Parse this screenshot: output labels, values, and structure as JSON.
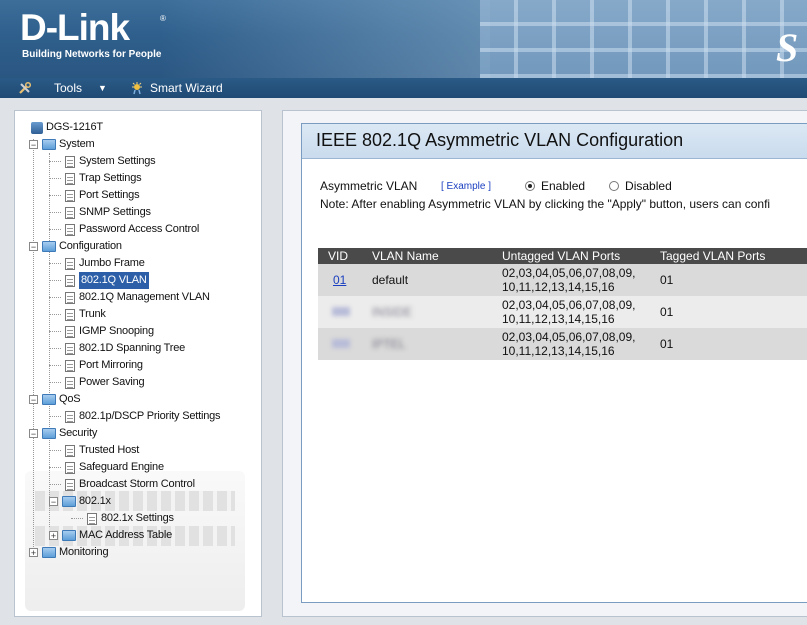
{
  "header": {
    "logo_title": "D-Link",
    "logo_registered": "®",
    "logo_subtitle": "Building Networks for People",
    "brand_mark": "S"
  },
  "menubar": {
    "tools_label": "Tools",
    "smart_wizard_label": "Smart Wizard"
  },
  "sidebar": {
    "tree": [
      {
        "label": "DGS-1216T",
        "icon": "device-icon",
        "level": 0
      },
      {
        "label": "System",
        "icon": "folder-icon",
        "level": 1,
        "expander": "−"
      },
      {
        "label": "System Settings",
        "icon": "page-icon",
        "level": 2
      },
      {
        "label": "Trap Settings",
        "icon": "page-icon",
        "level": 2
      },
      {
        "label": "Port Settings",
        "icon": "page-icon",
        "level": 2
      },
      {
        "label": "SNMP Settings",
        "icon": "page-icon",
        "level": 2
      },
      {
        "label": "Password Access Control",
        "icon": "page-icon",
        "level": 2
      },
      {
        "label": "Configuration",
        "icon": "folder-icon",
        "level": 1,
        "expander": "−"
      },
      {
        "label": "Jumbo Frame",
        "icon": "page-icon",
        "level": 2
      },
      {
        "label": "802.1Q VLAN",
        "icon": "page-icon",
        "level": 2,
        "selected": true
      },
      {
        "label": "802.1Q Management VLAN",
        "icon": "page-icon",
        "level": 2
      },
      {
        "label": "Trunk",
        "icon": "page-icon",
        "level": 2
      },
      {
        "label": "IGMP Snooping",
        "icon": "page-icon",
        "level": 2
      },
      {
        "label": "802.1D Spanning Tree",
        "icon": "page-icon",
        "level": 2
      },
      {
        "label": "Port Mirroring",
        "icon": "page-icon",
        "level": 2
      },
      {
        "label": "Power Saving",
        "icon": "page-icon",
        "level": 2
      },
      {
        "label": "QoS",
        "icon": "folder-icon",
        "level": 1,
        "expander": "−"
      },
      {
        "label": "802.1p/DSCP Priority Settings",
        "icon": "page-icon",
        "level": 2
      },
      {
        "label": "Security",
        "icon": "folder-icon",
        "level": 1,
        "expander": "−"
      },
      {
        "label": "Trusted Host",
        "icon": "page-icon",
        "level": 2
      },
      {
        "label": "Safeguard Engine",
        "icon": "page-icon",
        "level": 2
      },
      {
        "label": "Broadcast Storm Control",
        "icon": "page-icon",
        "level": 2
      },
      {
        "label": "802.1x",
        "icon": "folder-icon",
        "level": 2,
        "expander": "−"
      },
      {
        "label": "802.1x Settings",
        "icon": "page-icon",
        "level": 3
      },
      {
        "label": "MAC Address Table",
        "icon": "folder-icon",
        "level": 2,
        "expander": "+"
      },
      {
        "label": "Monitoring",
        "icon": "folder-icon",
        "level": 1,
        "expander": "+"
      }
    ]
  },
  "main": {
    "page_title": "IEEE 802.1Q Asymmetric VLAN Configuration",
    "asym_label": "Asymmetric VLAN",
    "example_link": "[ Example ]",
    "enabled_label": "Enabled",
    "disabled_label": "Disabled",
    "asymmetric_enabled": true,
    "note": "Note: After enabling Asymmetric VLAN by clicking the \"Apply\" button, users can confi",
    "table": {
      "headers": [
        "VID",
        "VLAN Name",
        "Untagged VLAN Ports",
        "Tagged VLAN Ports"
      ],
      "rows": [
        {
          "vid": "01",
          "name": "default",
          "untagged_1": "02,03,04,05,06,07,08,09,",
          "untagged_2": "10,11,12,13,14,15,16",
          "tagged": "01",
          "obscured": false
        },
        {
          "vid": "",
          "name": "INSIDE",
          "untagged_1": "02,03,04,05,06,07,08,09,",
          "untagged_2": "10,11,12,13,14,15,16",
          "tagged": "01",
          "obscured": true
        },
        {
          "vid": "",
          "name": "IPTEL",
          "untagged_1": "02,03,04,05,06,07,08,09,",
          "untagged_2": "10,11,12,13,14,15,16",
          "tagged": "01",
          "obscured": true
        }
      ]
    }
  },
  "colors": {
    "header_blue": "#2f5f8c",
    "selected_bg": "#2c5fa8",
    "table_header": "#4a4a4a",
    "link_blue": "#1a3fc0"
  }
}
